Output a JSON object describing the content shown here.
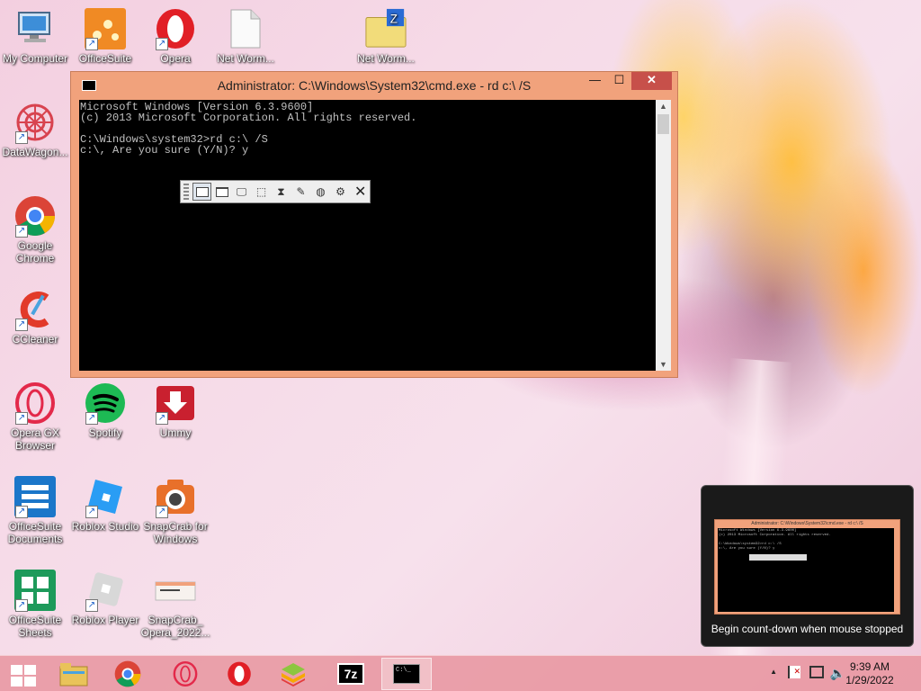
{
  "desktop": {
    "icons": [
      {
        "label": "My Computer",
        "icon": "computer-icon"
      },
      {
        "label": "OfficeSuite",
        "icon": "officesuite-icon"
      },
      {
        "label": "Opera",
        "icon": "opera-icon"
      },
      {
        "label": "Net Worm...",
        "icon": "file-icon"
      },
      {
        "label": "Net Worm...",
        "icon": "zip-folder-icon"
      },
      {
        "label": "DataWagon...",
        "icon": "datawagon-icon"
      },
      {
        "label": "Google Chrome",
        "icon": "chrome-icon"
      },
      {
        "label": "CCleaner",
        "icon": "ccleaner-icon"
      },
      {
        "label": "Opera GX Browser",
        "icon": "opera-gx-icon"
      },
      {
        "label": "Spotify",
        "icon": "spotify-icon"
      },
      {
        "label": "Ummy",
        "icon": "ummy-icon"
      },
      {
        "label": "OfficeSuite Documents",
        "icon": "officesuite-documents-icon"
      },
      {
        "label": "Roblox Studio",
        "icon": "roblox-studio-icon"
      },
      {
        "label": "SnapCrab for Windows",
        "icon": "snapcrab-icon"
      },
      {
        "label": "OfficeSuite Sheets",
        "icon": "officesuite-sheets-icon"
      },
      {
        "label": "Roblox Player",
        "icon": "roblox-player-icon"
      },
      {
        "label": "SnapCrab_ Opera_2022...",
        "icon": "image-file-icon"
      }
    ]
  },
  "cmd_window": {
    "title": "Administrator: C:\\Windows\\System32\\cmd.exe - rd  c:\\ /S",
    "controls": {
      "minimize": "—",
      "maximize": "☐",
      "close": "✕"
    },
    "lines": [
      "Microsoft Windows [Version 6.3.9600]",
      "(c) 2013 Microsoft Corporation. All rights reserved.",
      "",
      "C:\\Windows\\system32>rd c:\\ /S",
      "c:\\, Are you sure (Y/N)? y"
    ]
  },
  "snap_toolbar": {
    "buttons": [
      "window-capture",
      "client-capture",
      "screen-capture",
      "region-capture",
      "timer",
      "eyedropper",
      "web-capture",
      "settings"
    ],
    "close": "✕"
  },
  "preview": {
    "caption": "Begin count-down when mouse stopped",
    "title": "Administrator: C:\\Windows\\System32\\cmd.exe - rd c:\\ /S"
  },
  "taskbar": {
    "apps": [
      "file-explorer-icon",
      "chrome-icon",
      "opera-gx-icon",
      "opera-icon",
      "bluestacks-icon",
      "7zip-icon",
      "cmd-icon"
    ],
    "seven_zip_label": "7z",
    "cmd_label": "C:\\_",
    "tray_arrow": "▲",
    "time": "9:39 AM",
    "date": "1/29/2022"
  }
}
